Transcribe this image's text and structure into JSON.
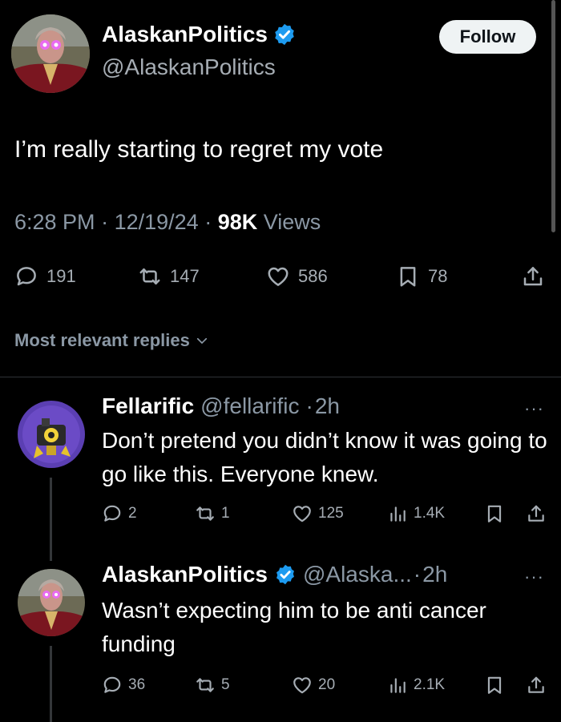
{
  "tweet": {
    "author_name": "AlaskanPolitics",
    "author_handle": "@AlaskanPolitics",
    "follow_label": "Follow",
    "text": "I’m really starting to regret my vote",
    "time": "6:28 PM",
    "date": "12/19/24",
    "views_count": "98K",
    "views_label": "Views",
    "replies": "191",
    "reposts": "147",
    "likes": "586",
    "bookmarks": "78"
  },
  "sort": {
    "label": "Most relevant replies"
  },
  "replies": [
    {
      "name": "Fellarific",
      "handle": "@fellarific",
      "time": "2h",
      "text": "Don’t pretend you didn’t know it was going to go like this. Everyone knew.",
      "replies": "2",
      "reposts": "1",
      "likes": "125",
      "views": "1.4K"
    },
    {
      "name": "AlaskanPolitics",
      "handle": "@Alaska...",
      "time": "2h",
      "text": "Wasn’t expecting him to be anti cancer funding",
      "replies": "36",
      "reposts": "5",
      "likes": "20",
      "views": "2.1K"
    }
  ],
  "colors": {
    "background": "#000000",
    "verified": "#1d9bf0",
    "secondary_text": "#8b98a5"
  },
  "icons": [
    "verified-badge-icon",
    "reply-icon",
    "repost-icon",
    "like-icon",
    "bookmark-icon",
    "share-icon",
    "views-icon",
    "chevron-down-icon",
    "more-icon"
  ]
}
